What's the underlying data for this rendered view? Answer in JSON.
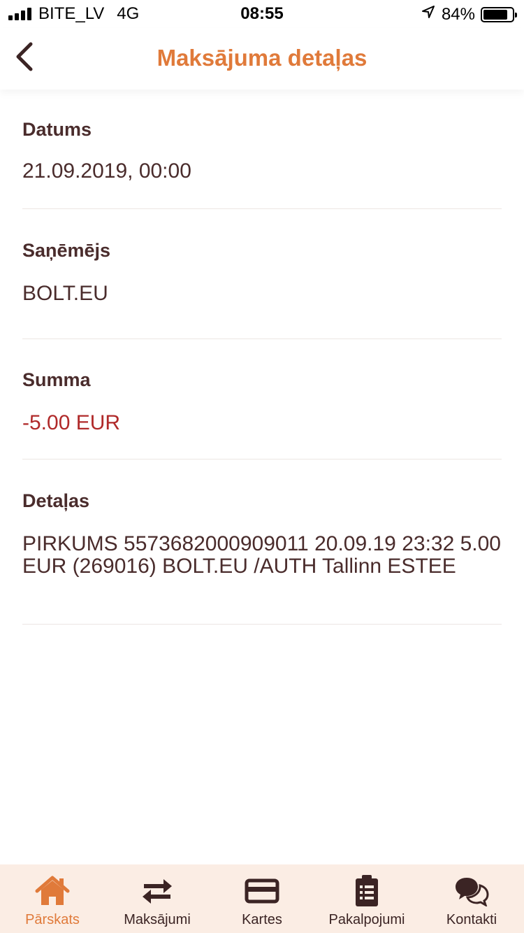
{
  "status_bar": {
    "carrier": "BITE_LV",
    "network": "4G",
    "time": "08:55",
    "battery_percent_label": "84%",
    "battery_level": 0.84
  },
  "header": {
    "title": "Maksājuma detaļas"
  },
  "fields": {
    "date": {
      "label": "Datums",
      "value": "21.09.2019, 00:00"
    },
    "recipient": {
      "label": "Saņēmējs",
      "value": "BOLT.EU"
    },
    "amount": {
      "label": "Summa",
      "value": "-5.00 EUR"
    },
    "details": {
      "label": "Detaļas",
      "value": "PIRKUMS 5573682000909011 20.09.19 23:32 5.00 EUR (269016) BOLT.EU /AUTH Tallinn ESTEE"
    }
  },
  "tabbar": {
    "items": [
      {
        "label": "Pārskats",
        "icon": "home-icon",
        "active": true
      },
      {
        "label": "Maksājumi",
        "icon": "transfer-arrows-icon"
      },
      {
        "label": "Kartes",
        "icon": "card-icon"
      },
      {
        "label": "Pakalpojumi",
        "icon": "clipboard-icon"
      },
      {
        "label": "Kontakti",
        "icon": "chat-bubbles-icon"
      }
    ]
  },
  "colors": {
    "accent": "#e07a3a",
    "text": "#4a2c2c",
    "negative": "#b02a2a",
    "tabbar_bg": "#fbede4"
  }
}
